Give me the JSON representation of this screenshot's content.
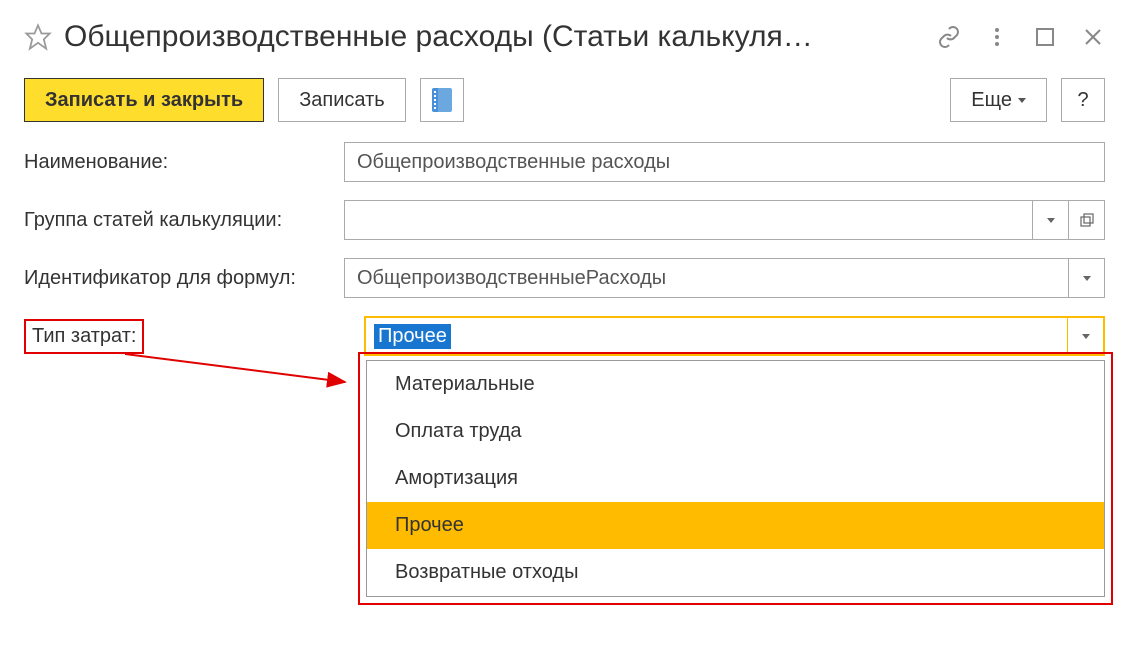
{
  "header": {
    "title": "Общепроизводственные расходы (Статьи калькуля…"
  },
  "toolbar": {
    "save_close": "Записать и закрыть",
    "save": "Записать",
    "more": "Еще",
    "help": "?"
  },
  "form": {
    "name_label": "Наименование:",
    "name_value": "Общепроизводственные расходы",
    "group_label": "Группа статей калькуляции:",
    "group_value": "",
    "id_label": "Идентификатор для формул:",
    "id_value": "ОбщепроизводственныеРасходы",
    "costtype_label": "Тип затрат:",
    "costtype_value": "Прочее"
  },
  "dropdown": {
    "items": [
      {
        "label": "Материальные"
      },
      {
        "label": "Оплата труда"
      },
      {
        "label": "Амортизация"
      },
      {
        "label": "Прочее"
      },
      {
        "label": "Возвратные отходы"
      }
    ],
    "selected_index": 3
  }
}
